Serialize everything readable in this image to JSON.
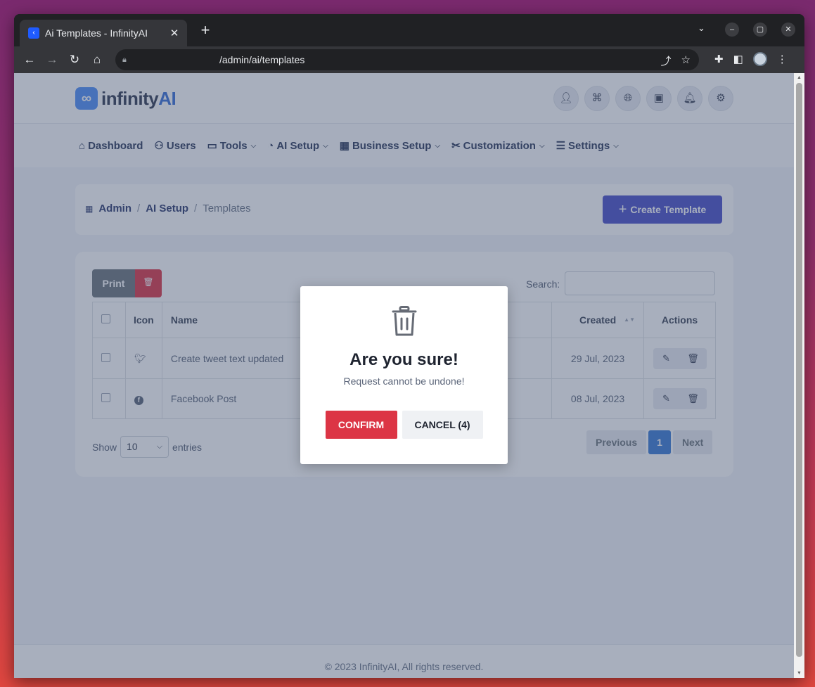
{
  "browser": {
    "tab_title": "Ai Templates - InfinityAI",
    "url": "/admin/ai/templates"
  },
  "brand": {
    "logo_text_1": "infinity",
    "logo_text_2": "AI",
    "accent": "#4a4fc9"
  },
  "nav": {
    "dashboard": "Dashboard",
    "users": "Users",
    "tools": "Tools",
    "ai_setup": "AI Setup",
    "business_setup": "Business Setup",
    "customization": "Customization",
    "settings": "Settings"
  },
  "breadcrumb": {
    "admin": "Admin",
    "ai_setup": "AI Setup",
    "current": "Templates"
  },
  "create_button": "Create Template",
  "table": {
    "print_label": "Print",
    "search_label": "Search:",
    "headers": {
      "icon": "Icon",
      "name": "Name",
      "created": "Created",
      "actions": "Actions"
    },
    "rows": [
      {
        "icon": "twitter-icon",
        "name": "Create tweet text updated",
        "created": "29 Jul, 2023"
      },
      {
        "icon": "facebook-icon",
        "name": "Facebook Post",
        "created": "08 Jul, 2023"
      }
    ],
    "show_label": "Show",
    "show_value": "10",
    "entries_label": "entries",
    "pager": {
      "previous": "Previous",
      "page": "1",
      "next": "Next"
    }
  },
  "footer": "© 2023 InfinityAI, All rights reserved.",
  "modal": {
    "title": "Are you sure!",
    "text": "Request cannot be undone!",
    "confirm": "CONFIRM",
    "cancel": "CANCEL (4)",
    "confirm_color": "#dc3545"
  }
}
